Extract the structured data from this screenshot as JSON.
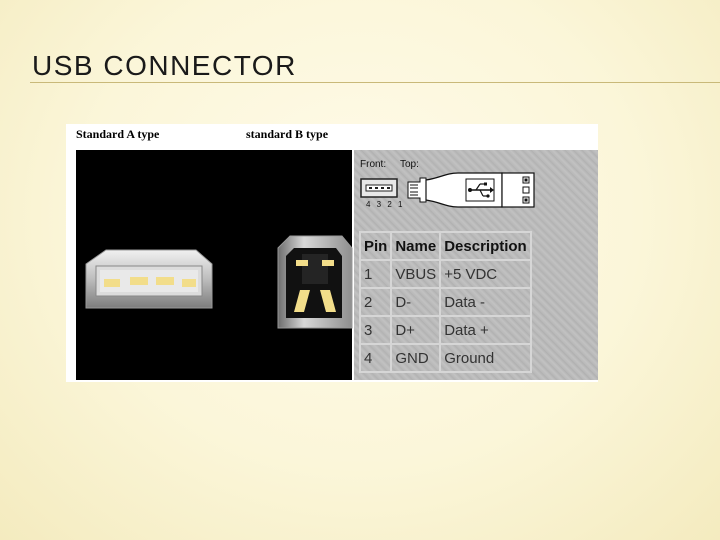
{
  "slide": {
    "title": "USB CONNECTOR"
  },
  "figure": {
    "caption_a": "Standard A type",
    "caption_b": "standard B type",
    "diagram": {
      "front_label": "Front:",
      "top_label": "Top:",
      "pin_numbers": "4 3 2 1"
    },
    "table": {
      "headers": [
        "Pin",
        "Name",
        "Description"
      ],
      "rows": [
        [
          "1",
          "VBUS",
          "+5 VDC"
        ],
        [
          "2",
          "D-",
          "Data -"
        ],
        [
          "3",
          "D+",
          "Data +"
        ],
        [
          "4",
          "GND",
          "Ground"
        ]
      ]
    }
  },
  "colors": {
    "background": "#fbf5d6",
    "title_rule": "#c9b979",
    "connector_gold": "#f2dd8a"
  },
  "icons": [
    "usb-a-connector-icon",
    "usb-b-connector-icon",
    "usb-trident-icon"
  ]
}
